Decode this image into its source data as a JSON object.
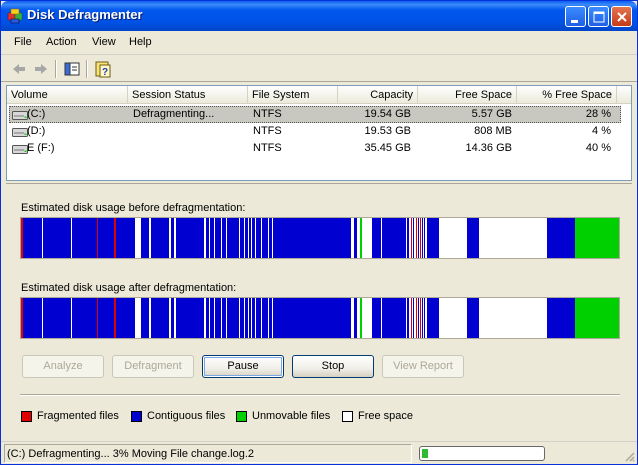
{
  "window": {
    "title": "Disk Defragmenter"
  },
  "menu": [
    "File",
    "Action",
    "View",
    "Help"
  ],
  "list": {
    "columns": [
      "Volume",
      "Session Status",
      "File System",
      "Capacity",
      "Free Space",
      "% Free Space"
    ],
    "rows": [
      {
        "volume": "(C:)",
        "status": "Defragmenting...",
        "fs": "NTFS",
        "capacity": "19.54 GB",
        "free": "5.57 GB",
        "pct": "28 %",
        "selected": true
      },
      {
        "volume": "(D:)",
        "status": "",
        "fs": "NTFS",
        "capacity": "19.53 GB",
        "free": "808 MB",
        "pct": "4 %",
        "selected": false
      },
      {
        "volume": "E (F:)",
        "status": "",
        "fs": "NTFS",
        "capacity": "35.45 GB",
        "free": "14.36 GB",
        "pct": "40 %",
        "selected": false
      }
    ]
  },
  "before_label": "Estimated disk usage before defragmentation:",
  "after_label": "Estimated disk usage after defragmentation:",
  "buttons": {
    "analyze": "Analyze",
    "defragment": "Defragment",
    "pause": "Pause",
    "stop": "Stop",
    "view_report": "View Report"
  },
  "legend": {
    "fragmented": {
      "label": "Fragmented files",
      "color": "#e00000"
    },
    "contiguous": {
      "label": "Contiguous files",
      "color": "#0000d0"
    },
    "unmovable": {
      "label": "Unmovable files",
      "color": "#00d000"
    },
    "free": {
      "label": "Free space",
      "color": "#ffffff"
    }
  },
  "status": {
    "text": "(C:) Defragmenting... 3%  Moving File change.log.2",
    "progress_percent": 3
  },
  "icons": {
    "app": "defrag-app-icon",
    "back": "back-arrow-icon",
    "forward": "forward-arrow-icon",
    "show_hide": "show-hide-console-tree-icon",
    "help": "help-icon"
  }
}
